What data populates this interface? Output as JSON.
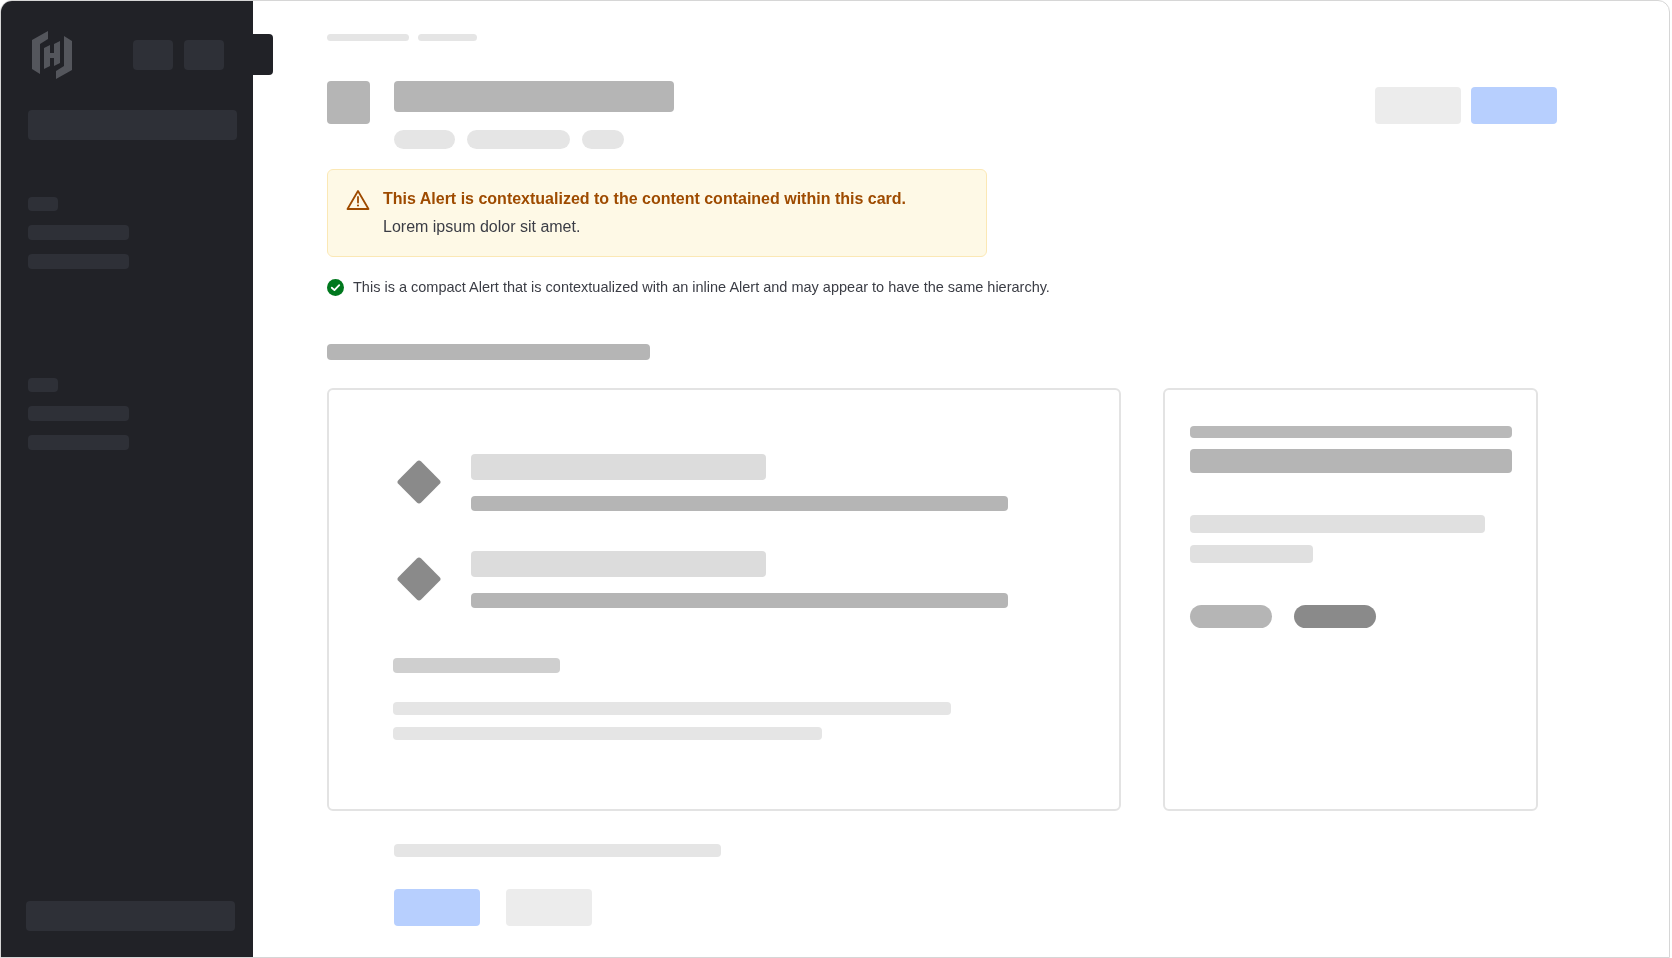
{
  "alerts": [
    {
      "kind": "warning",
      "title": "This Alert is contextualized to the content contained within this card.",
      "description": "Lorem ipsum dolor sit amet."
    },
    {
      "kind": "success",
      "description": "This is a compact Alert that is contextualized with an inline Alert and may appear to have the same hierarchy."
    }
  ]
}
